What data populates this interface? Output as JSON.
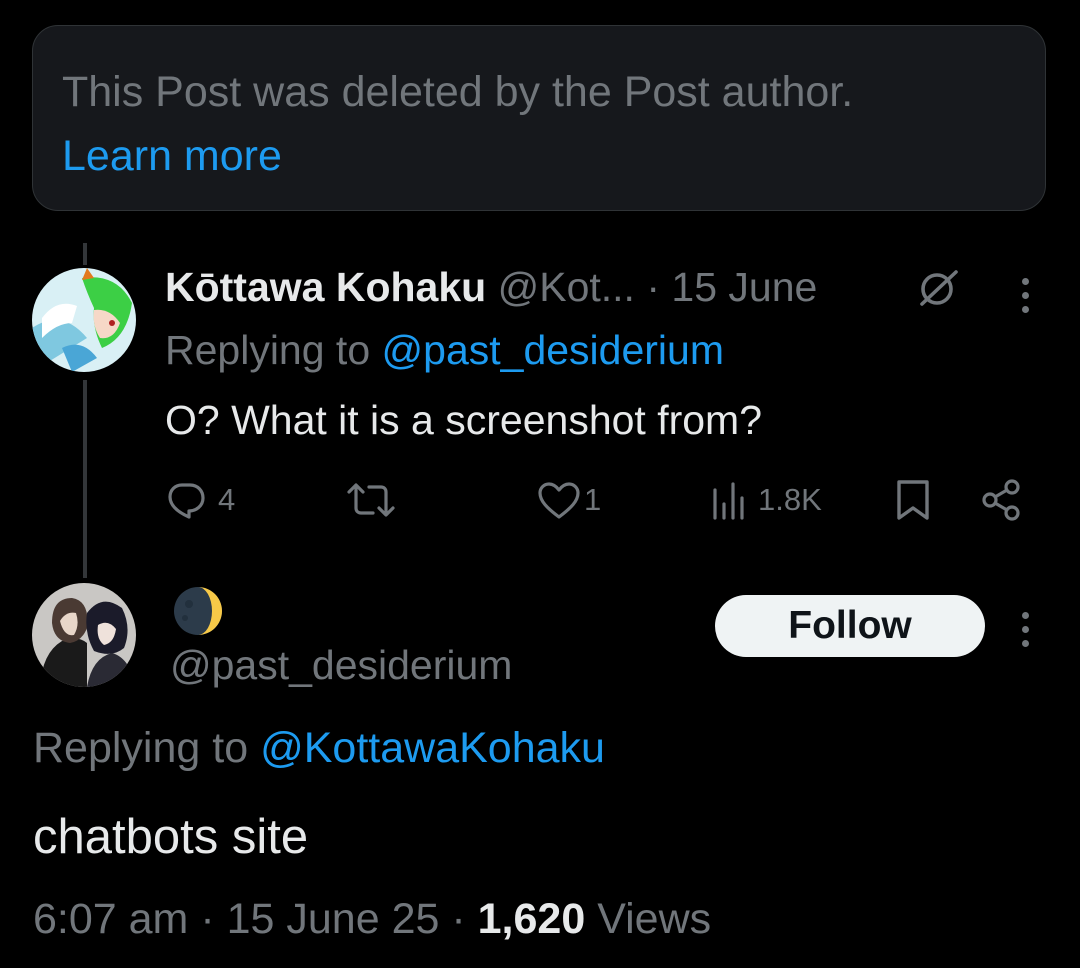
{
  "deleted_notice": {
    "text": "This Post was deleted by the Post author.",
    "link": "Learn more"
  },
  "reply_post": {
    "display_name": "Kōttawa Kohaku",
    "handle": "@Kot...",
    "separator": "·",
    "date": "15 June",
    "replying_prefix": "Replying to",
    "replying_handle": "@past_desiderium",
    "text": "O? What it is a screenshot from?",
    "replies": "4",
    "likes": "1",
    "views": "1.8K",
    "icons": [
      "reply-icon",
      "repost-icon",
      "like-icon",
      "views-icon",
      "bookmark-icon",
      "share-icon",
      "grok-icon",
      "more-icon"
    ]
  },
  "main_post": {
    "display_name_emoji": "🌒",
    "handle": "@past_desiderium",
    "follow_label": "Follow",
    "replying_prefix": "Replying to",
    "replying_handle": "@KottawaKohaku",
    "text": "chatbots site",
    "time": "6:07 am",
    "dot1": "·",
    "date": "15 June 25",
    "dot2": "·",
    "views_count": "1,620",
    "views_label": "Views"
  },
  "colors": {
    "background": "#000000",
    "accent": "#1d9bf0",
    "muted": "#71767b",
    "text": "#e7e9ea"
  }
}
